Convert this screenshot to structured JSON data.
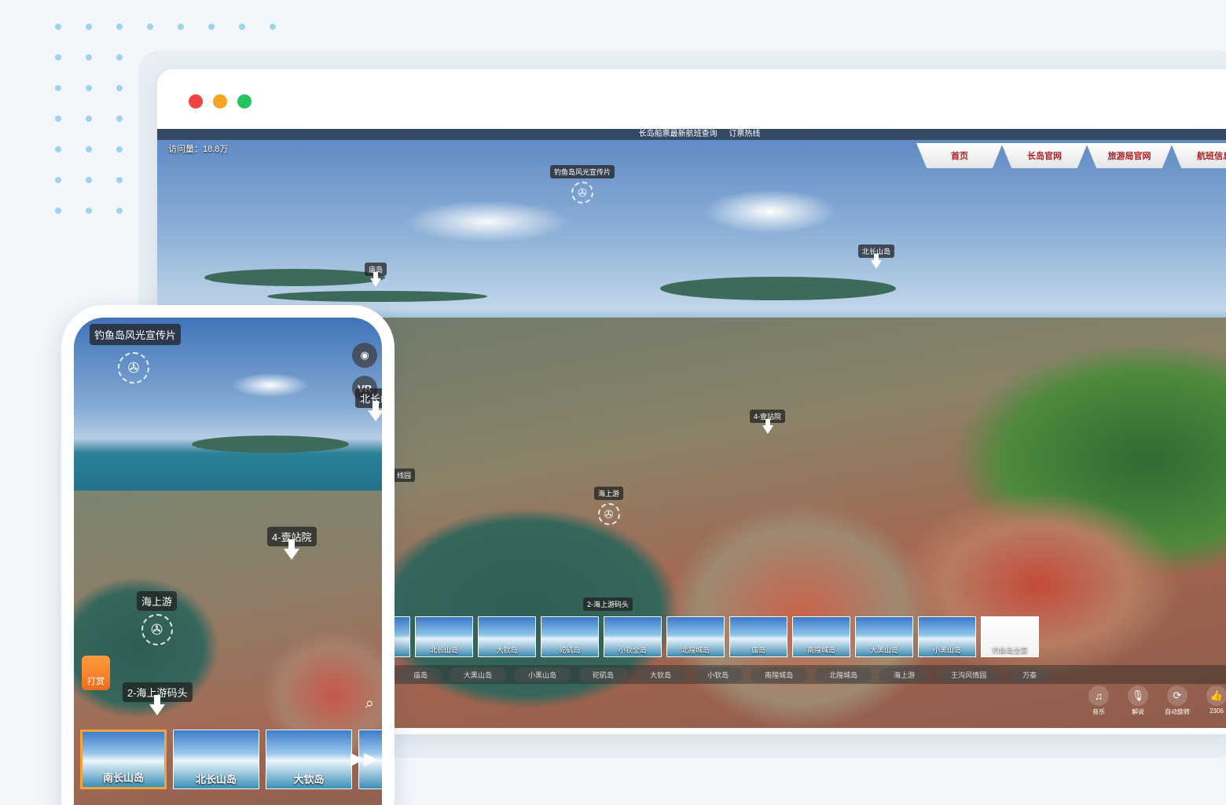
{
  "window": {
    "lights": [
      "#ef4444",
      "#f5a623",
      "#22c55e"
    ]
  },
  "top_links": [
    "长岛船票最新航班查询",
    "订票热线"
  ],
  "visits": "访问量：18.8万",
  "nav_tabs": [
    "首页",
    "长岛官网",
    "旅游局官网",
    "航班信息"
  ],
  "side_icons": [
    {
      "icon": "eye-icon",
      "glyph": "◉"
    },
    {
      "icon": "vr-icon",
      "glyph": "VR"
    }
  ],
  "hotspots": [
    {
      "id": "promo",
      "label": "钓鱼岛风光宣传片",
      "type": "video"
    },
    {
      "id": "tuodao",
      "label": "庙岛",
      "type": "arrow"
    },
    {
      "id": "beichangshan",
      "label": "北长山岛",
      "type": "arrow"
    },
    {
      "id": "yizhanyuan",
      "label": "4-壹站院",
      "type": "arrow"
    },
    {
      "id": "haishangyou",
      "label": "海上游",
      "type": "video"
    },
    {
      "id": "matou",
      "label": "2-海上游码头",
      "type": "arrow"
    },
    {
      "id": "edge",
      "label": "线园",
      "type": "label"
    }
  ],
  "thumbnails": [
    "北长山岛",
    "大钦岛",
    "砣矶岛",
    "小钦全岛",
    "北隍城岛",
    "庙岛",
    "南隍城岛",
    "大黑山岛",
    "小黑山岛",
    "钓鱼岛全景"
  ],
  "categories": [
    "庙岛",
    "大黑山岛",
    "小黑山岛",
    "砣矶岛",
    "大钦岛",
    "小钦岛",
    "南隍城岛",
    "北隍城岛",
    "海上游",
    "王沟风情园",
    "万泰"
  ],
  "tools": [
    {
      "icon": "music-icon",
      "glyph": "♫",
      "label": "音乐"
    },
    {
      "icon": "mic-icon",
      "glyph": "🎙",
      "label": "解说"
    },
    {
      "icon": "rotate-icon",
      "glyph": "⟳",
      "label": "自动旋转"
    },
    {
      "icon": "like-icon",
      "glyph": "👍",
      "label": "2306"
    }
  ],
  "phone": {
    "title": "钓鱼岛风光宣传片",
    "side_icons": [
      {
        "icon": "eye-icon",
        "glyph": "◉"
      },
      {
        "icon": "vr-icon",
        "glyph": "VR"
      }
    ],
    "hotspots": [
      {
        "label": "北长山",
        "type": "arrow"
      },
      {
        "label": "4-壹站院",
        "type": "arrow"
      },
      {
        "label": "海上游",
        "type": "video"
      },
      {
        "label": "2-海上游码头",
        "type": "arrow"
      }
    ],
    "tip_label": "打赏",
    "thumbnails": [
      "南长山岛",
      "北长山岛",
      "大钦岛"
    ],
    "next_glyph": "▶▶"
  }
}
